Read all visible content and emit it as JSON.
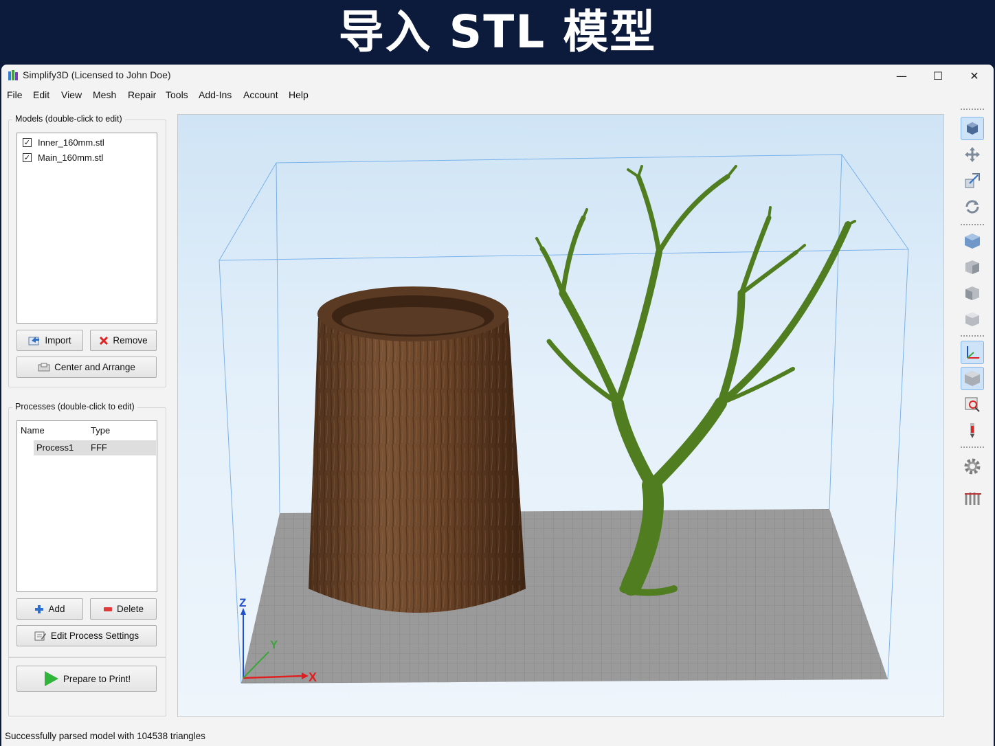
{
  "banner": {
    "title": "导入 STL 模型"
  },
  "window": {
    "title": "Simplify3D (Licensed to John Doe)",
    "controls": {
      "minimize": "—",
      "maximize": "☐",
      "close": "✕"
    }
  },
  "menu": [
    "File",
    "Edit",
    "View",
    "Mesh",
    "Repair",
    "Tools",
    "Add-Ins",
    "Account",
    "Help"
  ],
  "models": {
    "group_title": "Models (double-click to edit)",
    "items": [
      {
        "name": "Inner_160mm.stl",
        "checked": true
      },
      {
        "name": "Main_160mm.stl",
        "checked": true
      }
    ],
    "import_label": "Import",
    "remove_label": "Remove",
    "center_arrange_label": "Center and Arrange"
  },
  "processes": {
    "group_title": "Processes (double-click to edit)",
    "columns": {
      "name": "Name",
      "type": "Type"
    },
    "rows": [
      {
        "name": "Process1",
        "type": "FFF"
      }
    ],
    "add_label": "Add",
    "delete_label": "Delete",
    "edit_label": "Edit Process Settings",
    "prepare_label": "Prepare to Print!"
  },
  "viewport": {
    "axes": {
      "x": "X",
      "y": "Y",
      "z": "Z"
    },
    "colors": {
      "trunk": "#6b4428",
      "tree": "#4f7d1f",
      "bed": "#9a9a9a",
      "axis_x": "#e02020",
      "axis_y": "#3aa63a",
      "axis_z": "#1f4fcf"
    }
  },
  "toolbar_icons": [
    "view-model-icon",
    "move-icon",
    "scale-icon",
    "rotate-icon",
    "view-default-icon",
    "view-front-icon",
    "view-side-icon",
    "view-top-icon",
    "axes-toggle-icon",
    "build-volume-toggle-icon",
    "zoom-fit-icon",
    "nozzle-icon",
    "settings-gear-icon",
    "supports-icon"
  ],
  "status": {
    "message": "Successfully parsed model with 104538 triangles"
  }
}
